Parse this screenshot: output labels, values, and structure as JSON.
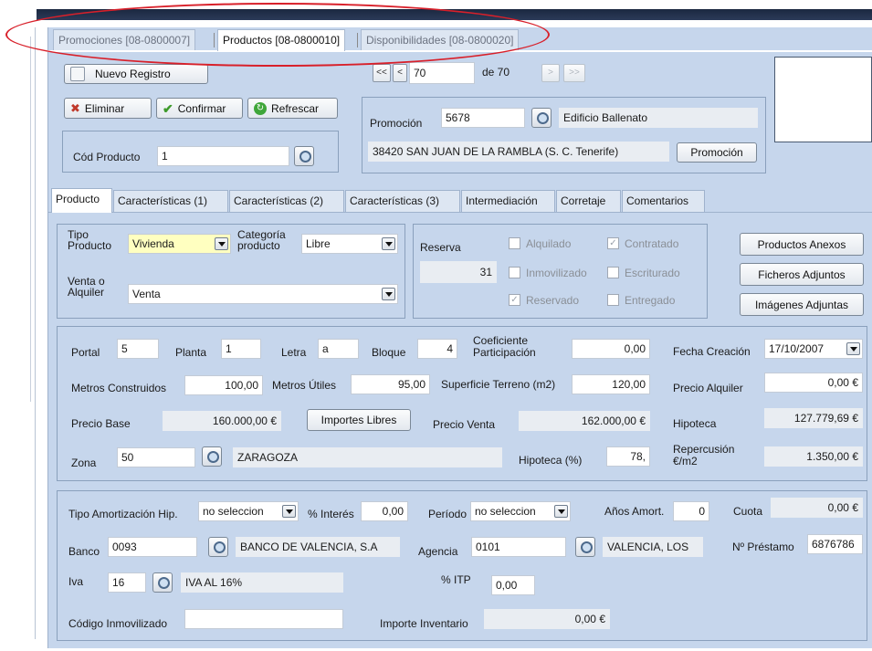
{
  "window_tabs": [
    {
      "label": "Promociones [08-0800007]",
      "active": false
    },
    {
      "label": "Productos [08-0800010]",
      "active": true
    },
    {
      "label": "Disponibilidades [08-0800020]",
      "active": false
    }
  ],
  "toolbar": {
    "nuevo_registro": "Nuevo Registro",
    "eliminar": "Eliminar",
    "confirmar": "Confirmar",
    "refrescar": "Refrescar"
  },
  "navigator": {
    "first": "<<",
    "prev": "<",
    "current": "70",
    "of_label": "de 70",
    "next": ">",
    "last": ">>"
  },
  "cod_producto": {
    "label": "Cód Producto",
    "value": "1"
  },
  "promocion": {
    "label": "Promoción",
    "code": "5678",
    "name": "Edificio Ballenato",
    "address": "38420 SAN JUAN DE LA RAMBLA (S. C. Tenerife)",
    "button": "Promoción"
  },
  "form_tabs": [
    "Producto",
    "Características (1)",
    "Características (2)",
    "Características (3)",
    "Intermediación",
    "Corretaje",
    "Comentarios"
  ],
  "tipo": {
    "tipo_producto_label": "Tipo Producto",
    "tipo_producto_value": "Vivienda",
    "categoria_label": "Categoría producto",
    "categoria_value": "Libre",
    "venta_label": "Venta o Alquiler",
    "venta_value": "Venta"
  },
  "reserva": {
    "label": "Reserva",
    "value": "31",
    "checks": [
      {
        "label": "Alquilado",
        "checked": false
      },
      {
        "label": "Contratado",
        "checked": true
      },
      {
        "label": "Inmovilizado",
        "checked": false
      },
      {
        "label": "Escriturado",
        "checked": false
      },
      {
        "label": "Reservado",
        "checked": true
      },
      {
        "label": "Entregado",
        "checked": false
      }
    ]
  },
  "side_buttons": [
    "Productos Anexos",
    "Ficheros Adjuntos",
    "Imágenes Adjuntas"
  ],
  "detalle": {
    "portal_label": "Portal",
    "portal": "5",
    "planta_label": "Planta",
    "planta": "1",
    "letra_label": "Letra",
    "letra": "a",
    "bloque_label": "Bloque",
    "bloque": "4",
    "coef_label": "Coeficiente Participación",
    "coef": "0,00",
    "fecha_label": "Fecha Creación",
    "fecha": "17/10/2007",
    "m_construidos_label": "Metros Construidos",
    "m_construidos": "100,00",
    "m_utiles_label": "Metros Útiles",
    "m_utiles": "95,00",
    "superficie_label": "Superficie Terreno (m2)",
    "superficie": "120,00",
    "precio_alquiler_label": "Precio Alquiler",
    "precio_alquiler": "0,00 €",
    "precio_base_label": "Precio Base",
    "precio_base": "160.000,00 €",
    "importes_libres": "Importes Libres",
    "precio_venta_label": "Precio Venta",
    "precio_venta": "162.000,00 €",
    "hipoteca_label": "Hipoteca",
    "hipoteca": "127.779,69 €",
    "zona_label": "Zona",
    "zona_code": "50",
    "zona_name": "ZARAGOZA",
    "hipoteca_pct_label": "Hipoteca (%)",
    "hipoteca_pct": "78,",
    "repercusion_label": "Repercusión €/m2",
    "repercusion": "1.350,00 €"
  },
  "financiacion": {
    "tipo_amort_label": "Tipo Amortización Hip.",
    "tipo_amort": "no seleccion",
    "interes_label": "% Interés",
    "interes": "0,00",
    "periodo_label": "Período",
    "periodo": "no seleccion",
    "anos_label": "Años Amort.",
    "anos": "0",
    "cuota_label": "Cuota",
    "cuota": "0,00 €",
    "banco_label": "Banco",
    "banco_code": "0093",
    "banco_name": "BANCO DE VALENCIA, S.A",
    "agencia_label": "Agencia",
    "agencia_code": "0101",
    "agencia_name": "VALENCIA, LOS",
    "prestamo_label": "Nº Préstamo",
    "prestamo": "6876786",
    "iva_label": "Iva",
    "iva_code": "16",
    "iva_name": "IVA AL 16%",
    "itp_label": "% ITP",
    "itp": "0,00",
    "cod_inmov_label": "Código Inmovilizado",
    "cod_inmov": "",
    "importe_inv_label": "Importe Inventario",
    "importe_inv": "0,00 €"
  },
  "colors": {
    "form_bg": "#c6d6ec",
    "highlight_ellipse": "#d8202a",
    "yellow_field": "#ffffc0"
  }
}
